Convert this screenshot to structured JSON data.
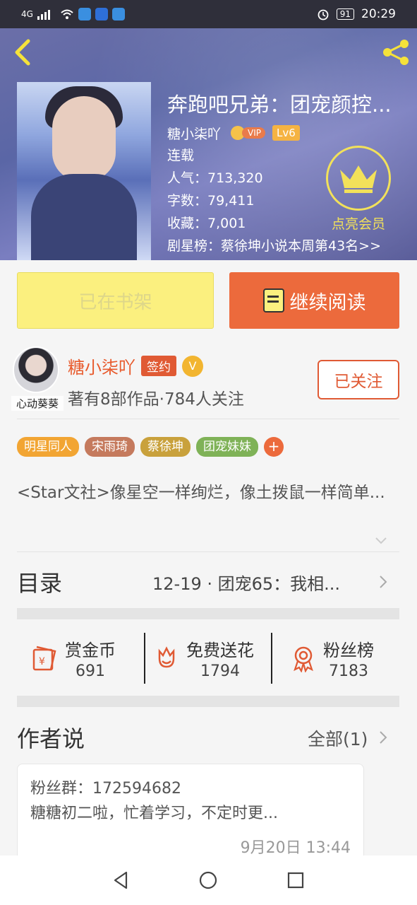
{
  "status_bar": {
    "signal": "4G",
    "battery": "91",
    "time": "20:29"
  },
  "book": {
    "title": "奔跑吧兄弟：团宠颜控...",
    "author": "糖小柒吖",
    "vip_label": "VIP",
    "level": "Lv6",
    "status": "连载",
    "popularity": "人气：713,320",
    "word_count": "字数：79,411",
    "favorites": "收藏：7,001",
    "ranking": "剧星榜：蔡徐坤小说本周第43名>>",
    "member_label": "点亮会员"
  },
  "actions": {
    "shelf_label": "已在书架",
    "read_label": "继续阅读"
  },
  "author_card": {
    "avatar_caption": "心动葵葵",
    "name": "糖小柒吖",
    "sign_badge": "签约",
    "verified_glyph": "V",
    "stats": "著有8部作品·784人关注",
    "follow_label": "已关注"
  },
  "tags": [
    {
      "label": "明星同人",
      "color": "#f2a533"
    },
    {
      "label": "宋雨琦",
      "color": "#c57a5d"
    },
    {
      "label": "蔡徐坤",
      "color": "#c9a13c"
    },
    {
      "label": "团宠妹妹",
      "color": "#7fb257"
    }
  ],
  "tag_more": "+",
  "description": "<Star文社>像星空一样绚烂，像土拨鼠一样简单...",
  "toc": {
    "label": "目录",
    "latest": "12-19 · 团宠65：我相..."
  },
  "stats": [
    {
      "label": "赏金币",
      "value": "691",
      "icon": "red-envelope-icon"
    },
    {
      "label": "免费送花",
      "value": "1794",
      "icon": "flower-icon"
    },
    {
      "label": "粉丝榜",
      "value": "7183",
      "icon": "medal-icon"
    }
  ],
  "author_says": {
    "title": "作者说",
    "all_label": "全部(1)",
    "line1": "粉丝群：172594682",
    "line2": "糖糖初二啦，忙着学习，不定时更...",
    "time": "9月20日  13:44"
  },
  "colors": {
    "accent": "#ec6a3c",
    "shelf": "#fbf07f",
    "gold": "#f2e15a"
  }
}
